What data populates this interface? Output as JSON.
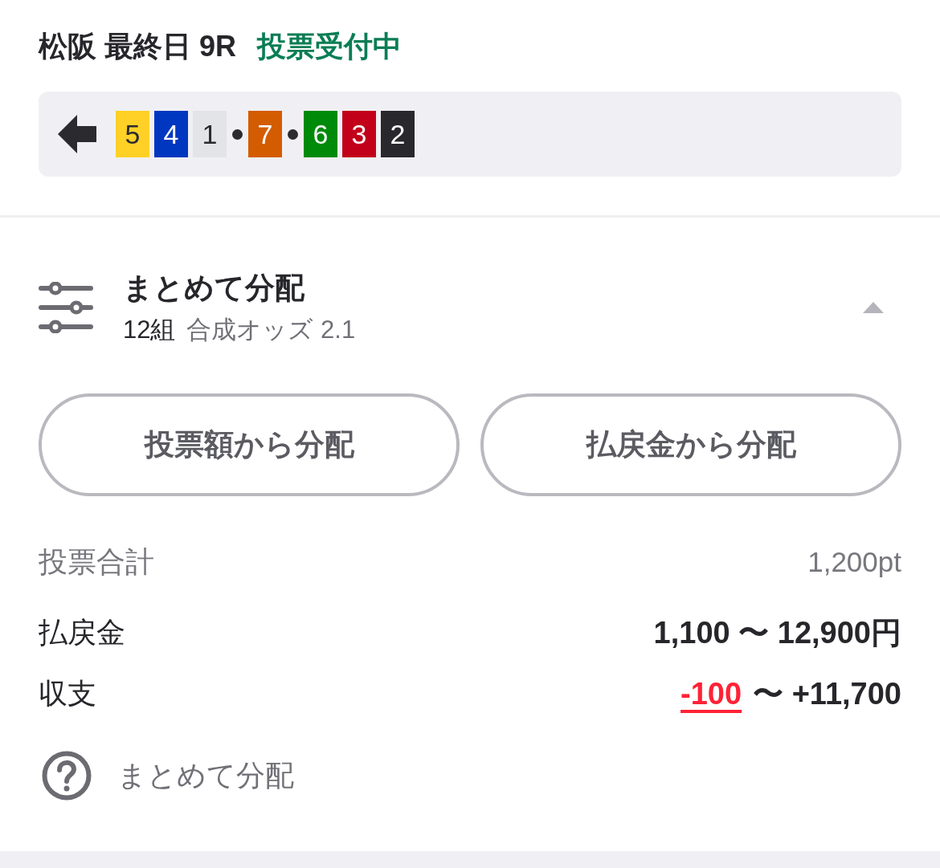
{
  "race": {
    "venue": "松阪",
    "day": "最終日",
    "number": "9R",
    "status": "投票受付中"
  },
  "combination": {
    "groups": [
      [
        {
          "label": "5",
          "color": "#ffd026"
        },
        {
          "label": "4",
          "color": "#0037c0"
        },
        {
          "label": "1",
          "color": "#e3e4e8"
        }
      ],
      [
        {
          "label": "7",
          "color": "#d45c00"
        }
      ],
      [
        {
          "label": "6",
          "color": "#008a0a"
        },
        {
          "label": "3",
          "color": "#c2001a"
        },
        {
          "label": "2",
          "color": "#28282d"
        }
      ]
    ]
  },
  "distribution": {
    "title": "まとめて分配",
    "count": "12組",
    "odds": "合成オッズ 2.1",
    "expanded": true
  },
  "buttons": [
    "投票額から分配",
    "払戻金から分配"
  ],
  "summary": [
    {
      "kind": "muted",
      "label": "投票合計",
      "value": "1,200pt"
    },
    {
      "kind": "strong",
      "label": "払戻金",
      "value": "1,100 〜 12,900円"
    },
    {
      "kind": "link",
      "label": "収支",
      "link": "-100",
      "value": "〜 +11,700"
    }
  ],
  "help": {
    "label": "まとめて分配"
  }
}
